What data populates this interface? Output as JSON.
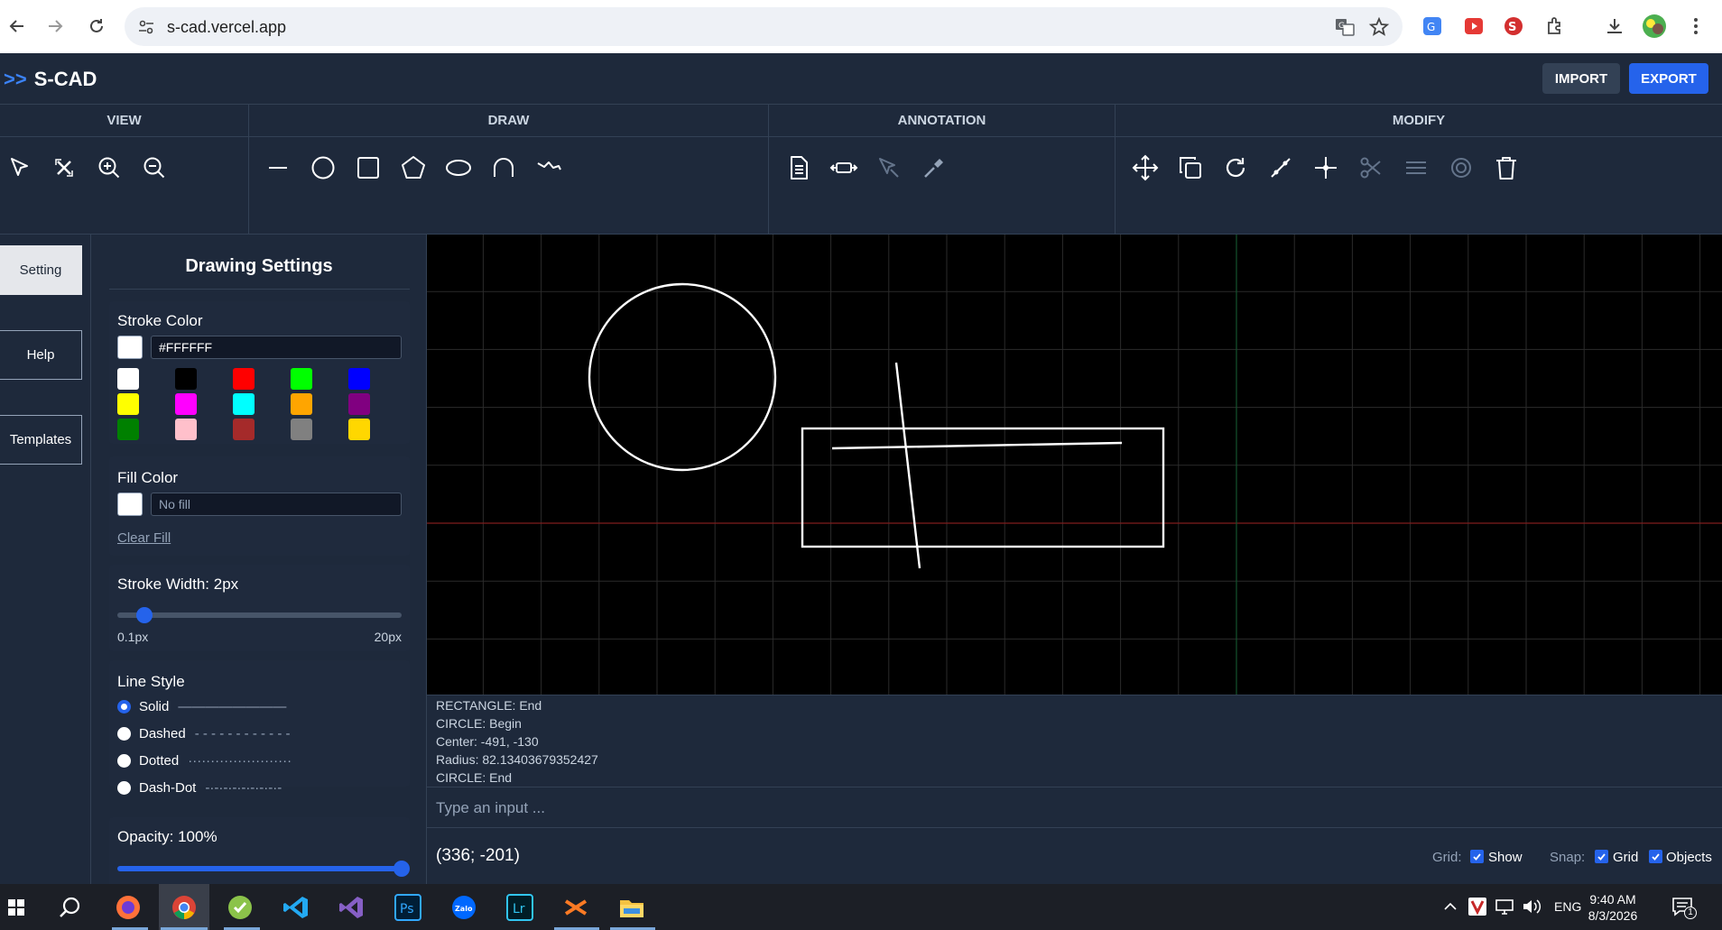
{
  "browser": {
    "url": "s-cad.vercel.app",
    "icons": [
      "back-arrow-icon",
      "forward-arrow-icon",
      "reload-icon",
      "site-settings-icon",
      "translate-icon",
      "star-icon",
      "extensions-icon",
      "download-icon",
      "profile-avatar",
      "menu-kebab-icon"
    ]
  },
  "app": {
    "brand_chevron": ">>",
    "brand_name": "S-CAD",
    "import_label": "IMPORT",
    "export_label": "EXPORT",
    "accent": "#2563eb"
  },
  "toolbar": {
    "groups": {
      "view": "VIEW",
      "draw": "DRAW",
      "annotation": "ANNOTATION",
      "modify": "MODIFY"
    },
    "view_tools": [
      "select-icon",
      "deselect-icon",
      "zoom-in-icon",
      "zoom-out-icon"
    ],
    "draw_tools": [
      "line-icon",
      "circle-icon",
      "rectangle-icon",
      "polygon-icon",
      "ellipse-icon",
      "arc-icon",
      "polyline-icon"
    ],
    "annotation_tools": [
      "text-icon",
      "dimension-icon",
      "leader-icon",
      "pin-icon"
    ],
    "modify_tools": [
      "move-icon",
      "copy-icon",
      "rotate-icon",
      "trim-icon",
      "extend-icon",
      "cut-icon",
      "offset-icon",
      "fillet-icon",
      "delete-icon"
    ]
  },
  "left_tabs": {
    "setting": "Setting",
    "help": "Help",
    "templates": "Templates"
  },
  "settings": {
    "title": "Drawing Settings",
    "stroke_color_label": "Stroke Color",
    "stroke_color_value": "#FFFFFF",
    "palette": [
      "#ffffff",
      "#000000",
      "#ff0000",
      "#00ff00",
      "#0000ff",
      "#ffff00",
      "#ff00ff",
      "#00ffff",
      "#ffa500",
      "#800080",
      "#008000",
      "#ffc0cb",
      "#a52a2a",
      "#808080",
      "#ffd700"
    ],
    "fill_color_label": "Fill Color",
    "fill_placeholder": "No fill",
    "clear_fill": "Clear Fill",
    "stroke_width_label": "Stroke Width: 2px",
    "stroke_width_min": "0.1px",
    "stroke_width_max": "20px",
    "stroke_width_value": 2,
    "line_style_label": "Line Style",
    "line_styles": [
      {
        "label": "Solid",
        "sample": "————————",
        "selected": true
      },
      {
        "label": "Dashed",
        "sample": "- - - - - - - - - - - -",
        "selected": false
      },
      {
        "label": "Dotted",
        "sample": "·······················",
        "selected": false
      },
      {
        "label": "Dash-Dot",
        "sample": "-·-·-·-·-·-·-·-·-",
        "selected": false
      }
    ],
    "opacity_label": "Opacity: 100%",
    "opacity_value": 1.0
  },
  "log": {
    "lines": [
      "RECTANGLE: End",
      "CIRCLE: Begin",
      "Center: -491, -130",
      "Radius: 82.13403679352427",
      "CIRCLE: End"
    ]
  },
  "command": {
    "placeholder": "Type an input ..."
  },
  "status": {
    "coords": "(336; -201)",
    "grid_label": "Grid:",
    "grid_show": "Show",
    "snap_label": "Snap:",
    "snap_grid": "Grid",
    "snap_objects": "Objects"
  },
  "taskbar": {
    "icons": [
      "windows-start-icon",
      "search-icon",
      "firefox-icon",
      "chrome-icon",
      "app-icon",
      "vscode-icon",
      "visual-studio-icon",
      "photoshop-icon",
      "zalo-icon",
      "lightroom-icon",
      "xampp-icon",
      "file-explorer-icon"
    ],
    "ps_label": "Ps",
    "lr_label": "Lr",
    "zalo_label": "Zalo",
    "lang": "ENG",
    "time": "9:40 AM",
    "date": "8/3/2026",
    "notif_count": "1"
  }
}
